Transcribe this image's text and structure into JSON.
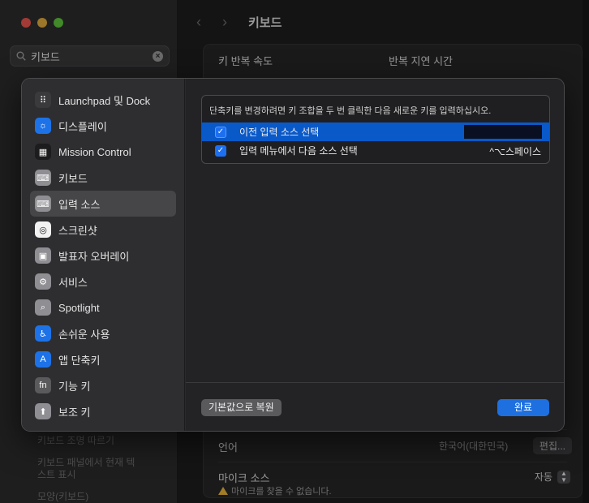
{
  "window": {
    "title": "키보드",
    "search": {
      "value": "키보드"
    }
  },
  "background": {
    "repeat_rate_label": "키 반복 속도",
    "repeat_delay_label": "반복 지연 시간",
    "sidebar_faded": [
      "키보드 조명 따르기",
      "키보드 패널에서 현재 텍스트 표시",
      "모양(키보드)"
    ],
    "language_label": "언어",
    "language_value": "한국어(대한민국)",
    "edit_label": "편집...",
    "mic_source_label": "마이크 소스",
    "mic_source_value": "자동",
    "mic_warning": "마이크를 찾을 수 없습니다."
  },
  "sheet": {
    "categories": [
      {
        "label": "Launchpad 및 Dock",
        "icon": "launchpad-icon",
        "color": "#3a3a3c"
      },
      {
        "label": "디스플레이",
        "icon": "display-icon",
        "color": "#1d72e8"
      },
      {
        "label": "Mission Control",
        "icon": "mission-control-icon",
        "color": "#1c1c1e"
      },
      {
        "label": "키보드",
        "icon": "keyboard-icon",
        "color": "#8e8e93"
      },
      {
        "label": "입력 소스",
        "icon": "input-sources-icon",
        "color": "#8e8e93"
      },
      {
        "label": "스크린샷",
        "icon": "screenshot-icon",
        "color": "#f2f2f2"
      },
      {
        "label": "발표자 오버레이",
        "icon": "presenter-overlay-icon",
        "color": "#8e8e93"
      },
      {
        "label": "서비스",
        "icon": "services-icon",
        "color": "#8e8e93"
      },
      {
        "label": "Spotlight",
        "icon": "spotlight-icon",
        "color": "#8e8e93"
      },
      {
        "label": "손쉬운 사용",
        "icon": "accessibility-icon",
        "color": "#1d72e8"
      },
      {
        "label": "앱 단축키",
        "icon": "app-shortcuts-icon",
        "color": "#1d72e8"
      },
      {
        "label": "기능 키",
        "icon": "function-keys-icon",
        "color": "#5a5a5c"
      },
      {
        "label": "보조 키",
        "icon": "modifier-keys-icon",
        "color": "#8e8e93"
      }
    ],
    "selected_index": 4,
    "hint": "단축키를 변경하려면 키 조합을 두 번 클릭한 다음 새로운 키를 입력하십시오.",
    "shortcuts": [
      {
        "label": "이전 입력 소스 선택",
        "checked": true,
        "keys": ""
      },
      {
        "label": "입력 메뉴에서 다음 소스 선택",
        "checked": true,
        "keys": "^⌥스페이스"
      }
    ],
    "restore_label": "기본값으로 복원",
    "done_label": "완료",
    "accent": "#1e6fe0"
  }
}
